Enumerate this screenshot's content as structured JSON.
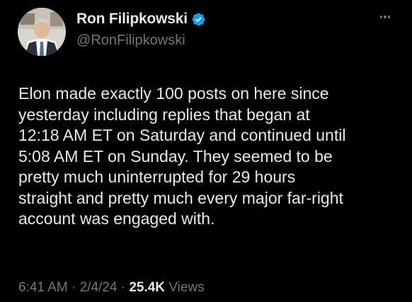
{
  "author": {
    "display_name": "Ron Filipkowski",
    "handle": "@RonFilipkowski",
    "verified_icon": "verified-badge-icon",
    "verified_color": "#1d9bf0"
  },
  "more_icon": "more-horizontal-icon",
  "tweet": {
    "lines": [
      "Elon made exactly 100 posts on here since",
      "yesterday including replies that began at",
      "12:18 AM ET on Saturday and continued until",
      "5:08 AM ET on Sunday. They seemed to be",
      "pretty much uninterrupted for 29 hours",
      "straight and pretty much every major far-right",
      "account was engaged with."
    ]
  },
  "meta": {
    "time": "6:41 AM",
    "separator": "·",
    "date": "2/4/24",
    "views_count": "25.4K",
    "views_label": "Views"
  },
  "colors": {
    "background": "#000000",
    "text_primary": "#e7e9ea",
    "text_secondary": "#71767b"
  }
}
